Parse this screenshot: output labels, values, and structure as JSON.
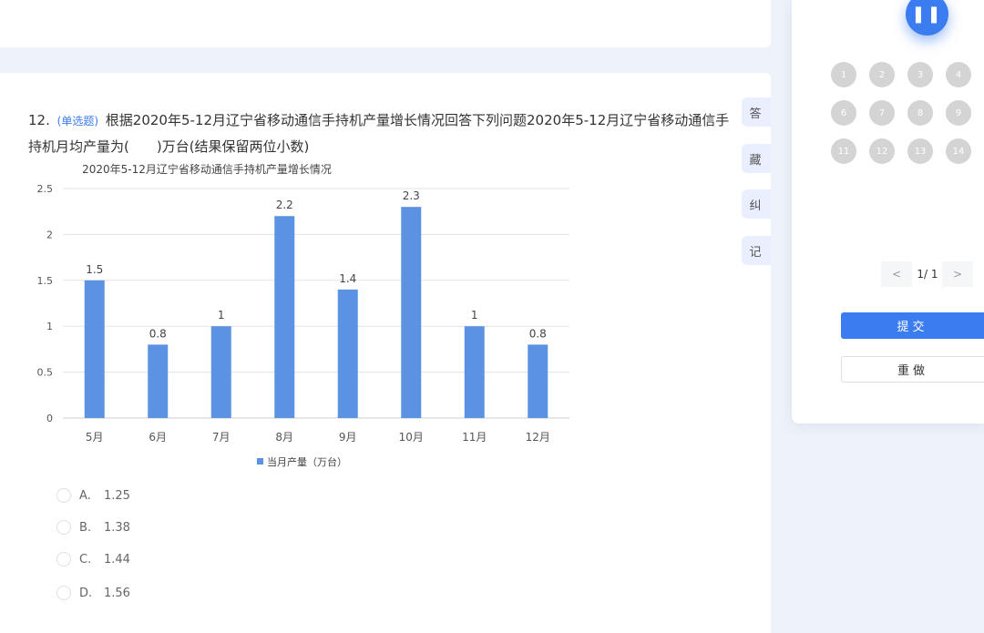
{
  "question": {
    "number": "12.",
    "type": "(单选题)",
    "text": "根据2020年5-12月辽宁省移动通信手持机产量增长情况回答下列问题2020年5-12月辽宁省移动通信手持机月均产量为(　　)万台(结果保留两位小数)"
  },
  "chart_data": {
    "type": "bar",
    "title": "2020年5-12月辽宁省移动通信手持机产量增长情况",
    "categories": [
      "5月",
      "6月",
      "7月",
      "8月",
      "9月",
      "10月",
      "11月",
      "12月"
    ],
    "series": [
      {
        "name": "当月产量（万台）",
        "values": [
          1.5,
          0.8,
          1,
          2.2,
          1.4,
          2.3,
          1,
          0.8
        ]
      }
    ],
    "data_labels": [
      "1.5",
      "0.8",
      "1",
      "2.2",
      "1.4",
      "2.3",
      "1",
      "0.8"
    ],
    "y_ticks": [
      "0",
      "0.5",
      "1",
      "1.5",
      "2",
      "2.5"
    ],
    "ylim": [
      0,
      2.5
    ],
    "grid": true,
    "legend": "bottom",
    "bar_color": "#5b93e2"
  },
  "options": [
    {
      "letter": "A.",
      "value": "1.25"
    },
    {
      "letter": "B.",
      "value": "1.38"
    },
    {
      "letter": "C.",
      "value": "1.44"
    },
    {
      "letter": "D.",
      "value": "1.56"
    }
  ],
  "side_tabs": [
    "答",
    "藏",
    "纠",
    "记"
  ],
  "panel": {
    "pause_label": "❚❚",
    "question_numbers": [
      "1",
      "2",
      "3",
      "4",
      "6",
      "7",
      "8",
      "9",
      "11",
      "12",
      "13",
      "14"
    ],
    "pager_prev": "<",
    "pager_text": "1/ 1",
    "pager_next": ">",
    "submit_label": "提交",
    "redo_label": "重做"
  },
  "colors": {
    "accent": "#3b7cf0",
    "bar": "#5b93e2"
  }
}
